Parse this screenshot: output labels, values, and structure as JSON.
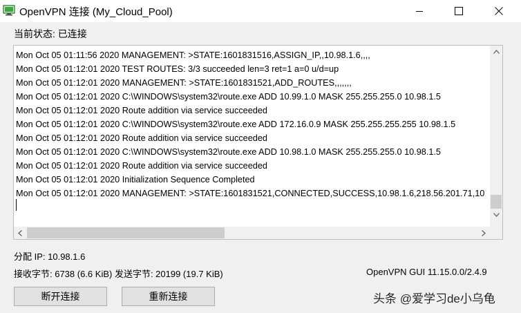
{
  "window": {
    "title": "OpenVPN 连接 (My_Cloud_Pool)",
    "controls": {
      "minimize_icon": "minimize-icon",
      "maximize_icon": "maximize-icon",
      "close_icon": "close-icon"
    }
  },
  "status": {
    "text": "当前状态: 已连接"
  },
  "log": {
    "lines": [
      "Mon Oct 05 01:11:56 2020 MANAGEMENT: >STATE:1601831516,ASSIGN_IP,,10.98.1.6,,,,",
      "Mon Oct 05 01:12:01 2020 TEST ROUTES: 3/3 succeeded len=3 ret=1 a=0 u/d=up",
      "Mon Oct 05 01:12:01 2020 MANAGEMENT: >STATE:1601831521,ADD_ROUTES,,,,,,,",
      "Mon Oct 05 01:12:01 2020 C:\\WINDOWS\\system32\\route.exe ADD 10.99.1.0 MASK 255.255.255.0 10.98.1.5",
      "Mon Oct 05 01:12:01 2020 Route addition via service succeeded",
      "Mon Oct 05 01:12:01 2020 C:\\WINDOWS\\system32\\route.exe ADD 172.16.0.9 MASK 255.255.255.255 10.98.1.5",
      "Mon Oct 05 01:12:01 2020 Route addition via service succeeded",
      "Mon Oct 05 01:12:01 2020 C:\\WINDOWS\\system32\\route.exe ADD 10.98.1.0 MASK 255.255.255.0 10.98.1.5",
      "Mon Oct 05 01:12:01 2020 Route addition via service succeeded",
      "Mon Oct 05 01:12:01 2020 Initialization Sequence Completed",
      "Mon Oct 05 01:12:01 2020 MANAGEMENT: >STATE:1601831521,CONNECTED,SUCCESS,10.98.1.6,218.56.201.71,10"
    ]
  },
  "info": {
    "assigned_ip": "分配 IP: 10.98.1.6",
    "bytes": "接收字节: 6738 (6.6 KiB) 发送字节: 20199 (19.7 KiB)",
    "version": "OpenVPN GUI 11.15.0.0/2.4.9"
  },
  "buttons": {
    "disconnect": "断开连接",
    "reconnect": "重新连接"
  },
  "watermark": "头条 @爱学习de小乌龟",
  "colors": {
    "titlebar": "#ffffff",
    "background": "#f0f0f0",
    "button": "#e1e1e1",
    "icon_green": "#3aa83a"
  }
}
